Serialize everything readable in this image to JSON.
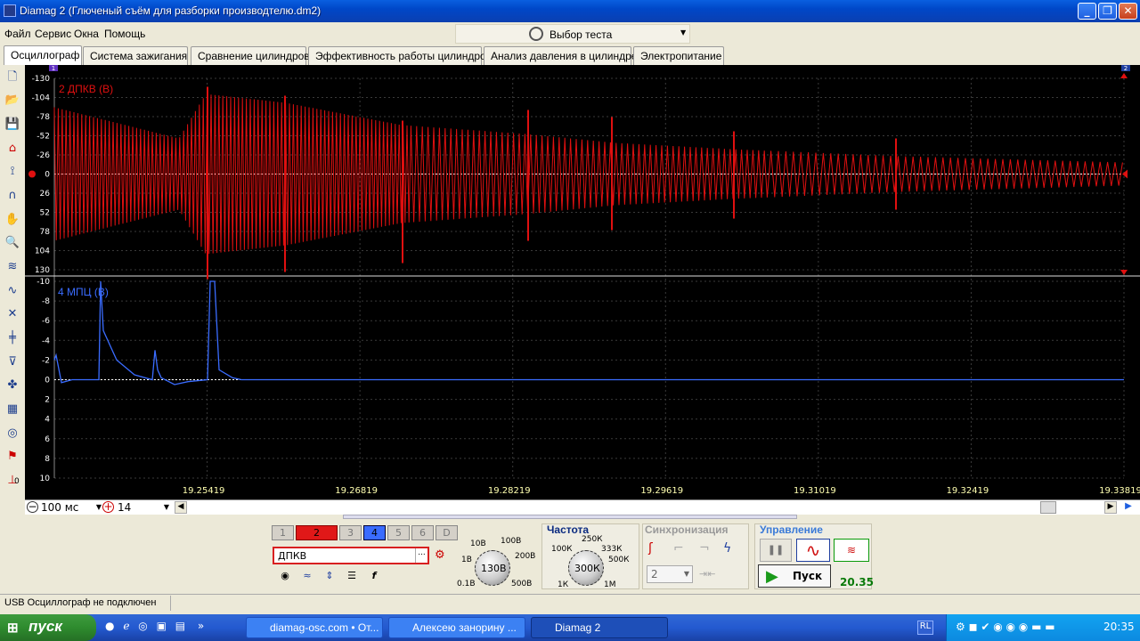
{
  "window": {
    "title": "Diamag 2 (Глюченый съём для разборки производтелю.dm2)"
  },
  "menu": [
    "Файл",
    "Сервис",
    "Окна",
    "Помощь"
  ],
  "test_selector": {
    "label": "Выбор теста"
  },
  "tabs": [
    "Осциллограф",
    "Система зажигания",
    "Сравнение цилиндров",
    "Эффективность работы цилиндров",
    "Анализ давления в цилиндре",
    "Электропитание"
  ],
  "active_tab": 0,
  "scope": {
    "channel1": {
      "label": "2 ДПКВ (В)",
      "color": "#e01010",
      "y_ticks": [
        "-130",
        "-104",
        "-78",
        "-52",
        "-26",
        "0",
        "26",
        "52",
        "78",
        "104",
        "130"
      ]
    },
    "channel2": {
      "label": "4 МПЦ (В)",
      "color": "#3a6cff",
      "y_ticks": [
        "-10",
        "-8",
        "-6",
        "-4",
        "-2",
        "0",
        "2",
        "4",
        "6",
        "8",
        "10"
      ]
    },
    "x_ticks": [
      "19.25419",
      "19.26819",
      "19.28219",
      "19.29619",
      "19.31019",
      "19.32419",
      "19.33819"
    ],
    "marker_left": "1",
    "marker_right": "2",
    "zero_marker_left": "0"
  },
  "bottom_controls": {
    "timebase": "100 мс",
    "zoom": "14"
  },
  "channels": {
    "buttons": [
      "1",
      "2",
      "3",
      "4",
      "5",
      "6",
      "D"
    ],
    "active": [
      "2",
      "4"
    ],
    "selected_name": "ДПКВ",
    "dots": "..."
  },
  "voltage": {
    "value": "130В",
    "labels": [
      "10В",
      "100В",
      "1В",
      "200В",
      "0.1В",
      "500В"
    ]
  },
  "frequency": {
    "title": "Частота",
    "value": "300К",
    "labels": [
      "250К",
      "100К",
      "333К",
      "500К",
      "1К",
      "1М"
    ]
  },
  "sync": {
    "title": "Синхронизация",
    "value": "2"
  },
  "control": {
    "title": "Управление",
    "start_label": "Пуск",
    "readout": "20.35"
  },
  "status": {
    "text": "USB Осциллограф не подключен"
  },
  "taskbar": {
    "start": "пуск",
    "tasks": [
      "diamag-osc.com • От...",
      "Алексею занорину ...",
      "Diamag 2"
    ],
    "tray_lang": "RL",
    "clock": "20:35"
  },
  "colors": {
    "scope_bg": "#000000",
    "grid": "#3a3a3a",
    "accent": "#0a5fe0"
  }
}
